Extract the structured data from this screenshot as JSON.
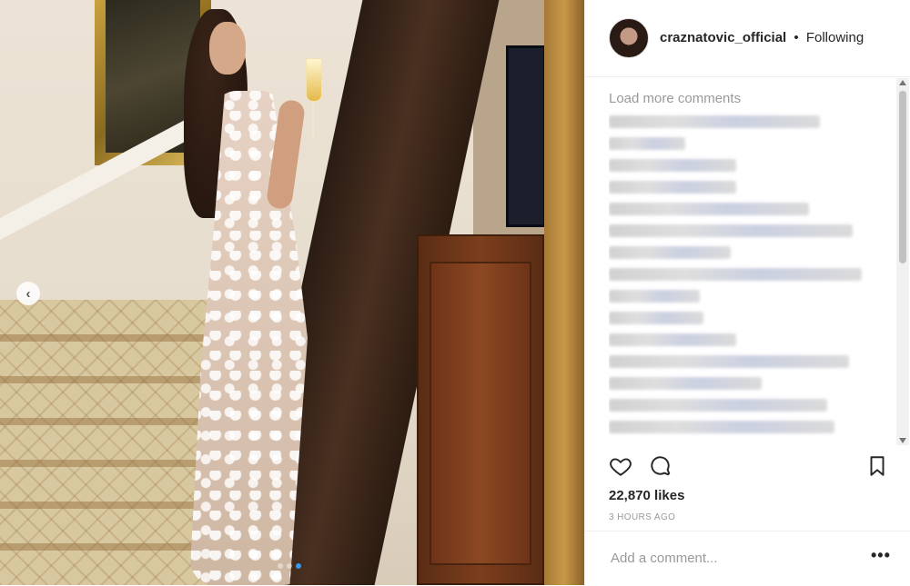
{
  "post": {
    "username": "craznatovic_official",
    "separator": "•",
    "follow_state": "Following",
    "load_more_label": "Load more comments",
    "likes_count": "22,870 likes",
    "timestamp": "3 HOURS AGO",
    "comment_placeholder": "Add a comment...",
    "more_options": "•••"
  },
  "carousel": {
    "prev_icon": "chevron-left-icon",
    "dot_count": 3,
    "active_dot": 2
  },
  "icons": {
    "like": "heart-outline-icon",
    "comment": "comment-bubble-icon",
    "save": "bookmark-icon"
  }
}
